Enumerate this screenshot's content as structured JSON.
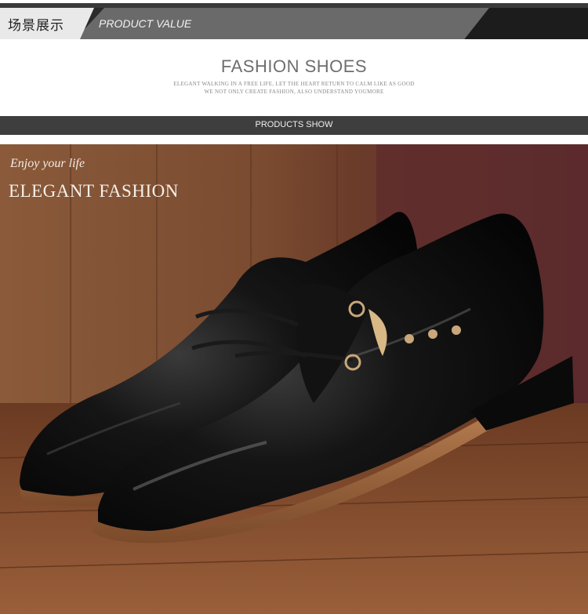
{
  "header": {
    "cn_title": "场景展示",
    "en_title": "PRODUCT VALUE"
  },
  "intro": {
    "headline": "FASHION SHOES",
    "tagline_1": "ELEGANT WALKING IN A FREE LIFE, LET THE HEART RETURN TO CALM LIKE AS GOOD",
    "tagline_2": "WE NOT ONLY CREATE FASHION, ALSO UNDERSTAND YOUMORE"
  },
  "section_bar": {
    "label": "PRODUCTS SHOW"
  },
  "photo": {
    "subject": "black leather lace-up dress shoes",
    "caption_small": "Enjoy your life",
    "caption_large": "ELEGANT FASHION"
  },
  "colors": {
    "dark_bar": "#3e3e3e",
    "header_grey": "#6a6a6a",
    "wood": "#7a4a2d",
    "leather": "#0d0d0d"
  }
}
